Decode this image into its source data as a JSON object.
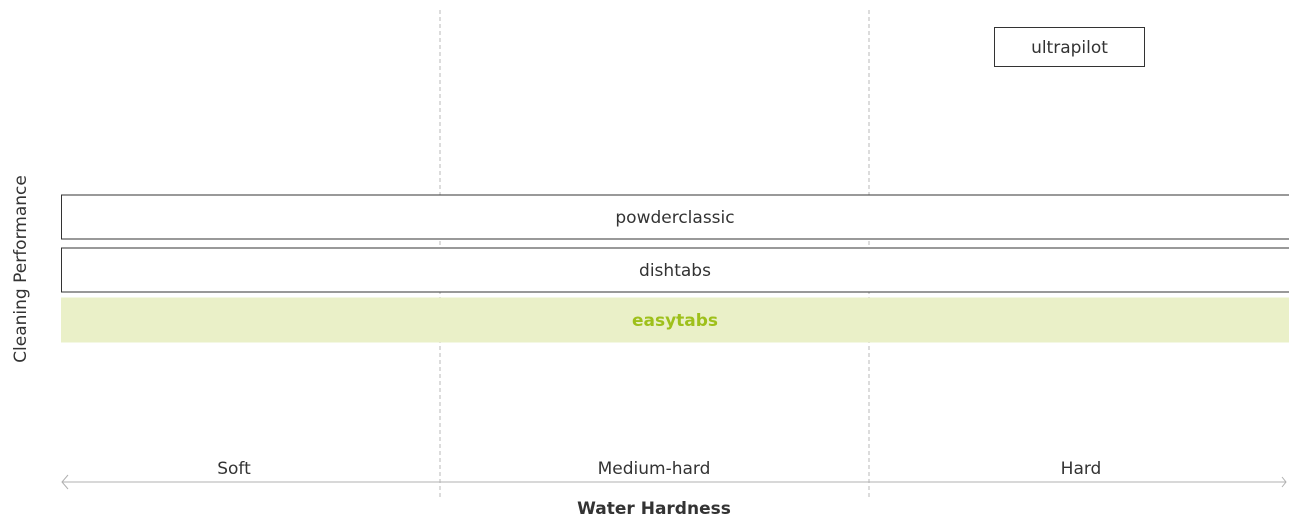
{
  "chart_data": {
    "type": "bar",
    "xlabel": "Water Hardness",
    "ylabel": "Cleaning Performance",
    "categories": [
      "Soft",
      "Medium-hard",
      "Hard"
    ],
    "x_range": [
      0,
      3
    ],
    "products": [
      {
        "name": "ultrapilot",
        "x_start": 2.3,
        "x_end": 2.65,
        "level": 4,
        "style": "outlined"
      },
      {
        "name": "powderclassic",
        "x_start": 0,
        "x_end": 3,
        "level": 3,
        "style": "outlined"
      },
      {
        "name": "dishtabs",
        "x_start": 0,
        "x_end": 3,
        "level": 2,
        "style": "outlined"
      },
      {
        "name": "easytabs",
        "x_start": 0,
        "x_end": 3,
        "level": 1,
        "style": "highlighted"
      }
    ],
    "grid": "dashed vertical separators between categories",
    "colors": {
      "highlight_fill": "#eaf0c8",
      "highlight_text": "#9ec01b",
      "outline": "#333333",
      "text": "#333333",
      "grid": "#b8b8b8",
      "axis": "#b0b0b0"
    }
  }
}
